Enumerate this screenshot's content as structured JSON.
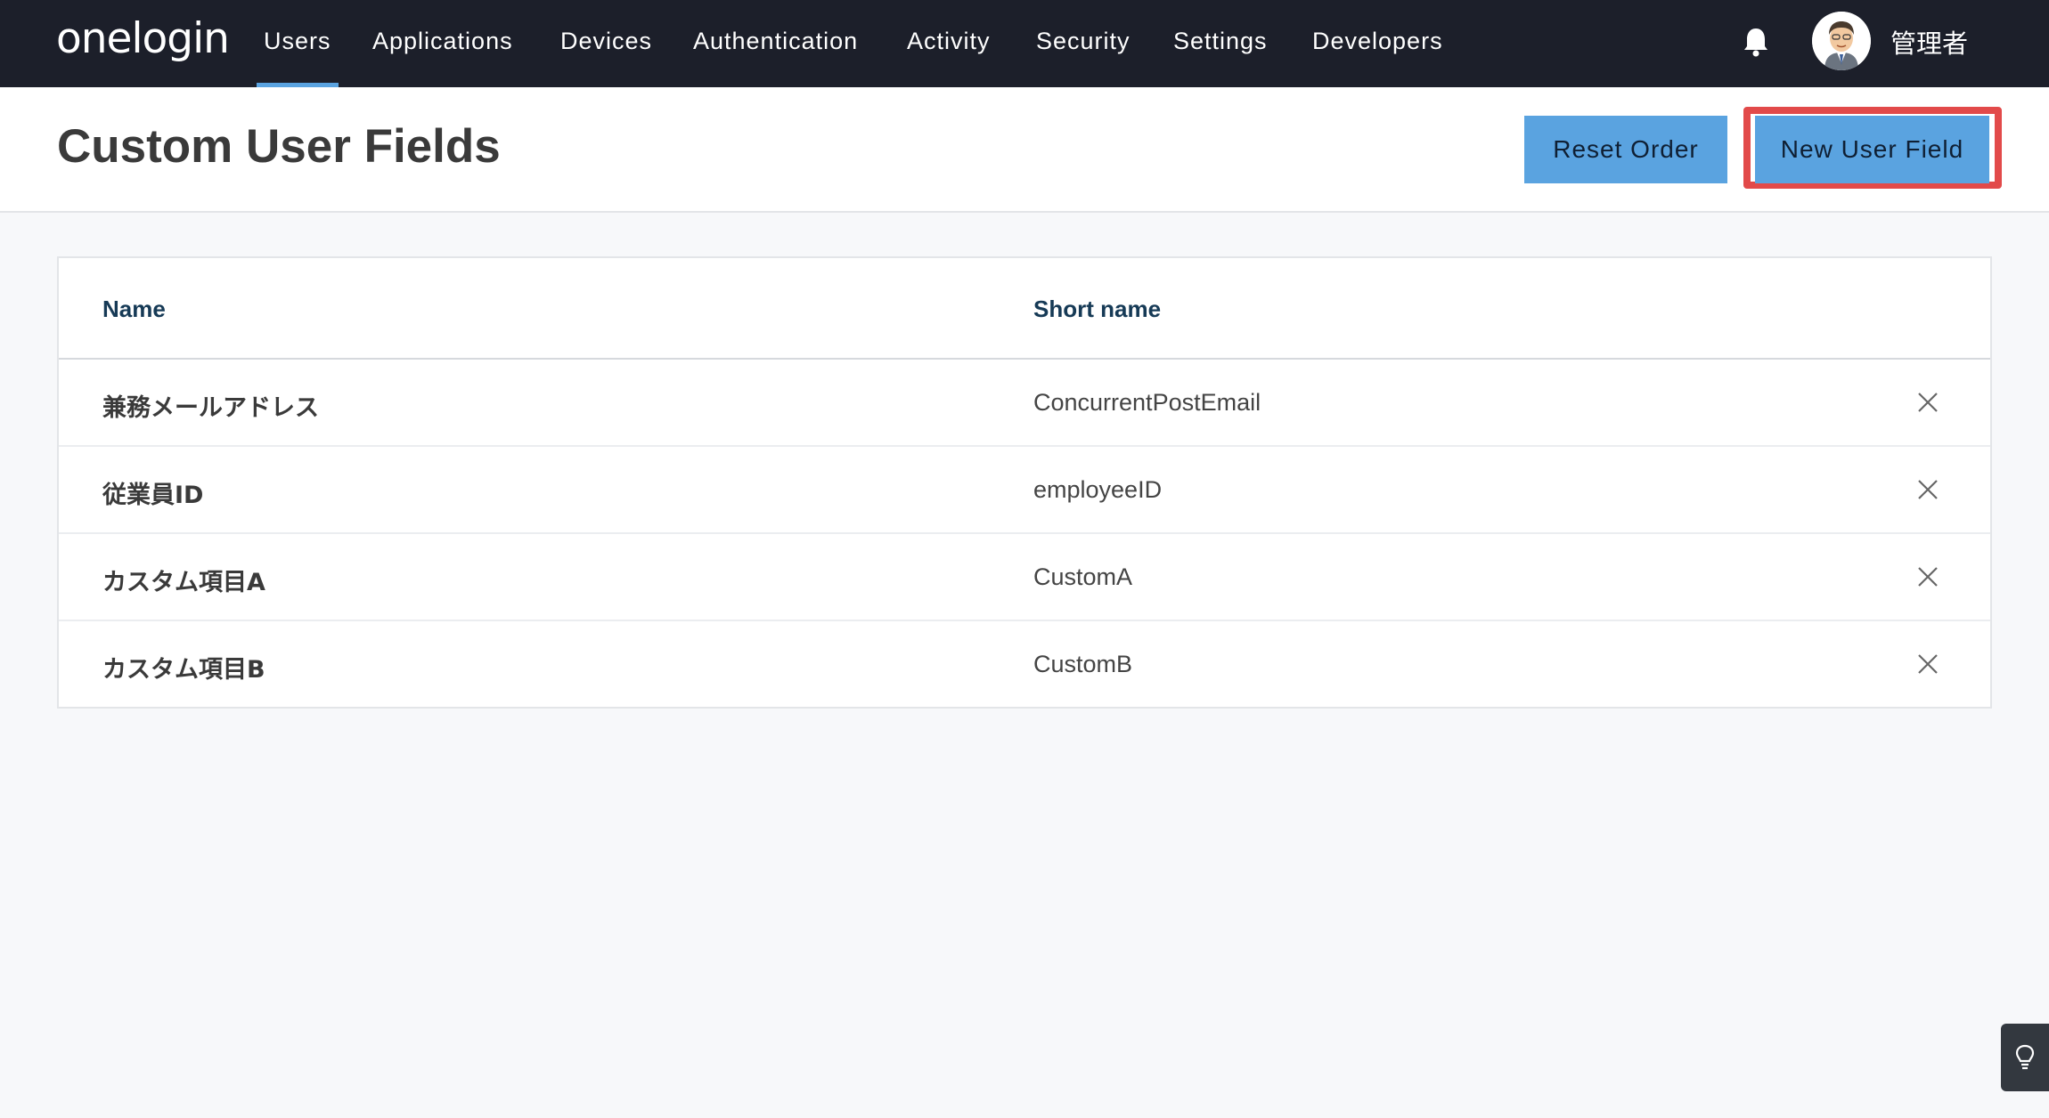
{
  "brand": {
    "logo_text": "onelogin"
  },
  "nav": {
    "items": [
      {
        "label": "Users",
        "active": true
      },
      {
        "label": "Applications",
        "active": false
      },
      {
        "label": "Devices",
        "active": false
      },
      {
        "label": "Authentication",
        "active": false
      },
      {
        "label": "Activity",
        "active": false
      },
      {
        "label": "Security",
        "active": false
      },
      {
        "label": "Settings",
        "active": false
      },
      {
        "label": "Developers",
        "active": false
      }
    ],
    "notification_icon": "bell-icon",
    "user": {
      "name": "管理者",
      "avatar_icon": "user-avatar"
    }
  },
  "page": {
    "title": "Custom User Fields",
    "buttons": {
      "reset_order": "Reset Order",
      "new_user_field": "New User Field"
    }
  },
  "table": {
    "columns": [
      "Name",
      "Short name"
    ],
    "rows": [
      {
        "name": "兼務メールアドレス",
        "short_name": "ConcurrentPostEmail"
      },
      {
        "name": "従業員ID",
        "short_name": "employeeID"
      },
      {
        "name": "カスタム項目A",
        "short_name": "CustomA"
      },
      {
        "name": "カスタム項目B",
        "short_name": "CustomB"
      }
    ],
    "row_action_icon": "close-icon"
  },
  "help": {
    "icon": "lightbulb-icon"
  },
  "colors": {
    "nav_bg": "#1c1f2a",
    "accent": "#5aa3e0",
    "highlight": "#e24a4a",
    "header_text": "#163a56"
  }
}
